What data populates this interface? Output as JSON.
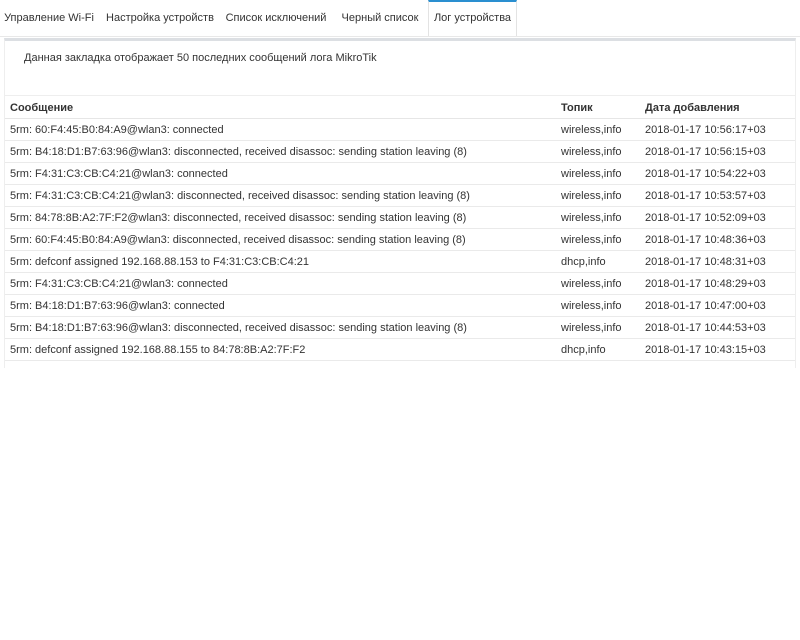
{
  "tabs": [
    {
      "label": "Управление Wi-Fi",
      "active": false
    },
    {
      "label": "Настройка устройств",
      "active": false
    },
    {
      "label": "Список исключений",
      "active": false
    },
    {
      "label": "Черный список",
      "active": false
    },
    {
      "label": "Лог устройства",
      "active": true
    }
  ],
  "colors": {
    "active_tab_accent": "#2a8fd0",
    "panel_border": "#dcdfe3"
  },
  "log": {
    "description": "Данная закладка отображает 50 последних сообщений лога MikroTik",
    "columns": [
      "Сообщение",
      "Топик",
      "Дата добавления"
    ],
    "rows": [
      {
        "message": "5rm: 60:F4:45:B0:84:A9@wlan3: connected",
        "topic": "wireless,info",
        "date": "2018-01-17 10:56:17+03"
      },
      {
        "message": "5rm: B4:18:D1:B7:63:96@wlan3: disconnected, received disassoc: sending station leaving (8)",
        "topic": "wireless,info",
        "date": "2018-01-17 10:56:15+03"
      },
      {
        "message": "5rm: F4:31:C3:CB:C4:21@wlan3: connected",
        "topic": "wireless,info",
        "date": "2018-01-17 10:54:22+03"
      },
      {
        "message": "5rm: F4:31:C3:CB:C4:21@wlan3: disconnected, received disassoc: sending station leaving (8)",
        "topic": "wireless,info",
        "date": "2018-01-17 10:53:57+03"
      },
      {
        "message": "5rm: 84:78:8B:A2:7F:F2@wlan3: disconnected, received disassoc: sending station leaving (8)",
        "topic": "wireless,info",
        "date": "2018-01-17 10:52:09+03"
      },
      {
        "message": "5rm: 60:F4:45:B0:84:A9@wlan3: disconnected, received disassoc: sending station leaving (8)",
        "topic": "wireless,info",
        "date": "2018-01-17 10:48:36+03"
      },
      {
        "message": "5rm: defconf assigned 192.168.88.153 to F4:31:C3:CB:C4:21",
        "topic": "dhcp,info",
        "date": "2018-01-17 10:48:31+03"
      },
      {
        "message": "5rm: F4:31:C3:CB:C4:21@wlan3: connected",
        "topic": "wireless,info",
        "date": "2018-01-17 10:48:29+03"
      },
      {
        "message": "5rm: B4:18:D1:B7:63:96@wlan3: connected",
        "topic": "wireless,info",
        "date": "2018-01-17 10:47:00+03"
      },
      {
        "message": "5rm: B4:18:D1:B7:63:96@wlan3: disconnected, received disassoc: sending station leaving (8)",
        "topic": "wireless,info",
        "date": "2018-01-17 10:44:53+03"
      },
      {
        "message": "5rm: defconf assigned 192.168.88.155 to 84:78:8B:A2:7F:F2",
        "topic": "dhcp,info",
        "date": "2018-01-17 10:43:15+03"
      }
    ]
  }
}
